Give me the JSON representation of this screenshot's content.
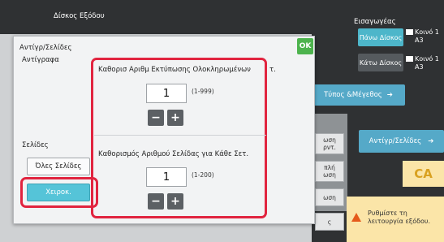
{
  "background": {
    "output_tray_label": "Δίσκος Εξόδου",
    "input_label": "Εισαγωγέας",
    "upper_tray": {
      "label": "Πάνω Δίσκος",
      "info1": "Κοινό 1",
      "info2": "A3"
    },
    "lower_tray": {
      "label": "Κάτω Δίσκος",
      "info1": "Κοινό 1",
      "info2": "A3"
    },
    "size_button_label": "Τύπος &Μέγεθος",
    "copy_pages_button_label": "Αντίγρ/Σελίδες",
    "ca_label": "CA",
    "warning_text_line1": "Ρυθμίστε τη",
    "warning_text_line2": "λειτουργία εξόδου.",
    "mid_frag_1": "ωση",
    "mid_frag_2": "ρντ.",
    "mid_frag_3": "πλή",
    "mid_frag_4": "ωση",
    "mid_frag_5": "ωση",
    "mid_frag_6": "ς"
  },
  "dialog": {
    "title": "Αντίγρ/Σελίδες",
    "ok_label": "OK",
    "copies_label": "Αντίγραφα",
    "pages_label": "Σελίδες",
    "all_pages_label": "Όλες Σελίδες",
    "manual_label": "Χειροκ.",
    "set_count_title": "Καθορισ Αριθμ Εκτύπωσης Ολοκληρωμένων",
    "set_count_suffix": "τ.",
    "set_count_value": "1",
    "set_count_range": "(1-999)",
    "page_count_title": "Καθορισμός Αριθμού Σελίδας για Κάθε Σετ.",
    "page_count_value": "1",
    "page_count_range": "(1-200)",
    "minus_label": "−",
    "plus_label": "+"
  },
  "colors": {
    "highlight": "#e1243f",
    "accent": "#55c4d8",
    "ok": "#4db34d"
  }
}
